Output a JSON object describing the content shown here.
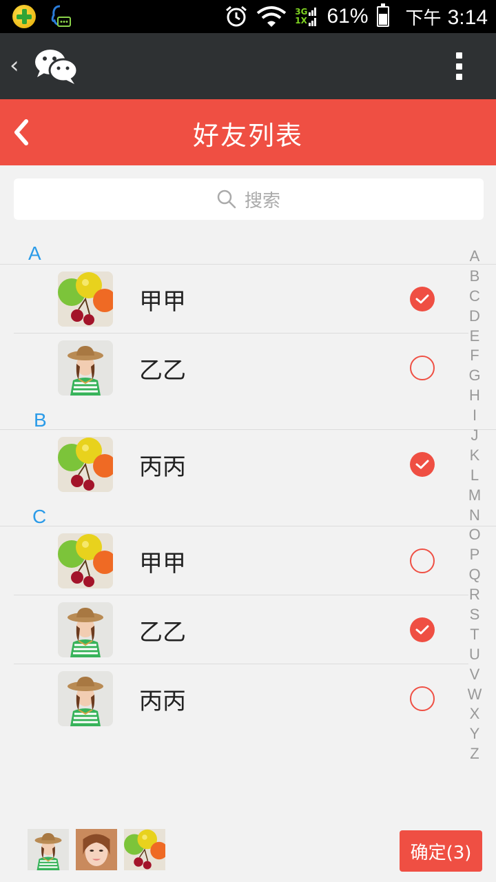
{
  "status_bar": {
    "network_top": "3G",
    "network_bottom": "1X",
    "battery_percent": "61%",
    "ampm": "下午",
    "time": "3:14"
  },
  "app_bar": {
    "back_glyph": "‹",
    "logo": "wechat-logo"
  },
  "title_bar": {
    "title": "好友列表"
  },
  "search": {
    "placeholder": "搜索"
  },
  "sections": [
    {
      "letter": "A",
      "items": [
        {
          "name": "甲甲",
          "avatar": "fruit",
          "checked": true
        },
        {
          "name": "乙乙",
          "avatar": "woman-hat",
          "checked": false
        }
      ]
    },
    {
      "letter": "B",
      "items": [
        {
          "name": "丙丙",
          "avatar": "fruit",
          "checked": true
        }
      ]
    },
    {
      "letter": "C",
      "items": [
        {
          "name": "甲甲",
          "avatar": "fruit",
          "checked": false
        },
        {
          "name": "乙乙",
          "avatar": "woman-hat",
          "checked": true
        },
        {
          "name": "丙丙",
          "avatar": "woman-hat",
          "checked": false
        }
      ]
    }
  ],
  "index_letters": [
    "A",
    "B",
    "C",
    "D",
    "E",
    "F",
    "G",
    "H",
    "I",
    "J",
    "K",
    "L",
    "M",
    "N",
    "O",
    "P",
    "Q",
    "R",
    "S",
    "T",
    "U",
    "V",
    "W",
    "X",
    "Y",
    "Z"
  ],
  "selected_avatars": [
    "woman-hat",
    "woman-face",
    "fruit"
  ],
  "confirm": {
    "label": "确定(3)"
  },
  "colors": {
    "accent": "#ef4f43",
    "section_letter": "#2b9be8",
    "dark_bar": "#2e3133"
  }
}
